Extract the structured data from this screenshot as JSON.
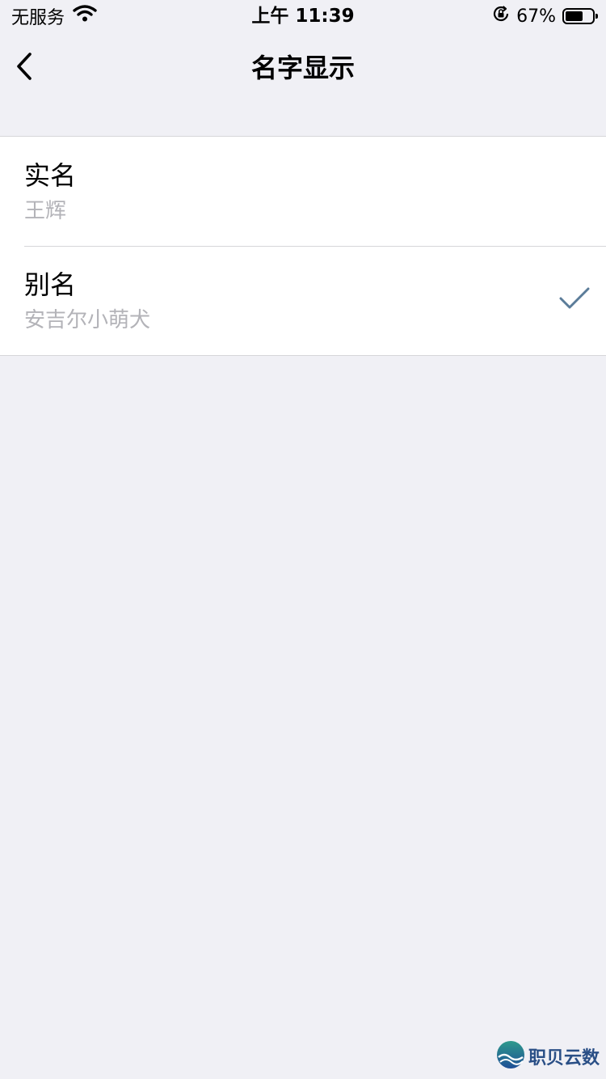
{
  "status_bar": {
    "carrier": "无服务",
    "time": "上午 11:39",
    "battery_percent_text": "67%",
    "battery_level": 0.67
  },
  "nav": {
    "title": "名字显示",
    "back_icon": "chevron-left-icon"
  },
  "options": [
    {
      "title": "实名",
      "subtitle": "王辉",
      "selected": false
    },
    {
      "title": "别名",
      "subtitle": "安吉尔小萌犬",
      "selected": true
    }
  ],
  "colors": {
    "background": "#f0f0f5",
    "check": "#5b7c99",
    "subtitle": "#b3b3b8",
    "watermark_text": "#2a4f86"
  },
  "watermark": {
    "text": "职贝云数"
  }
}
